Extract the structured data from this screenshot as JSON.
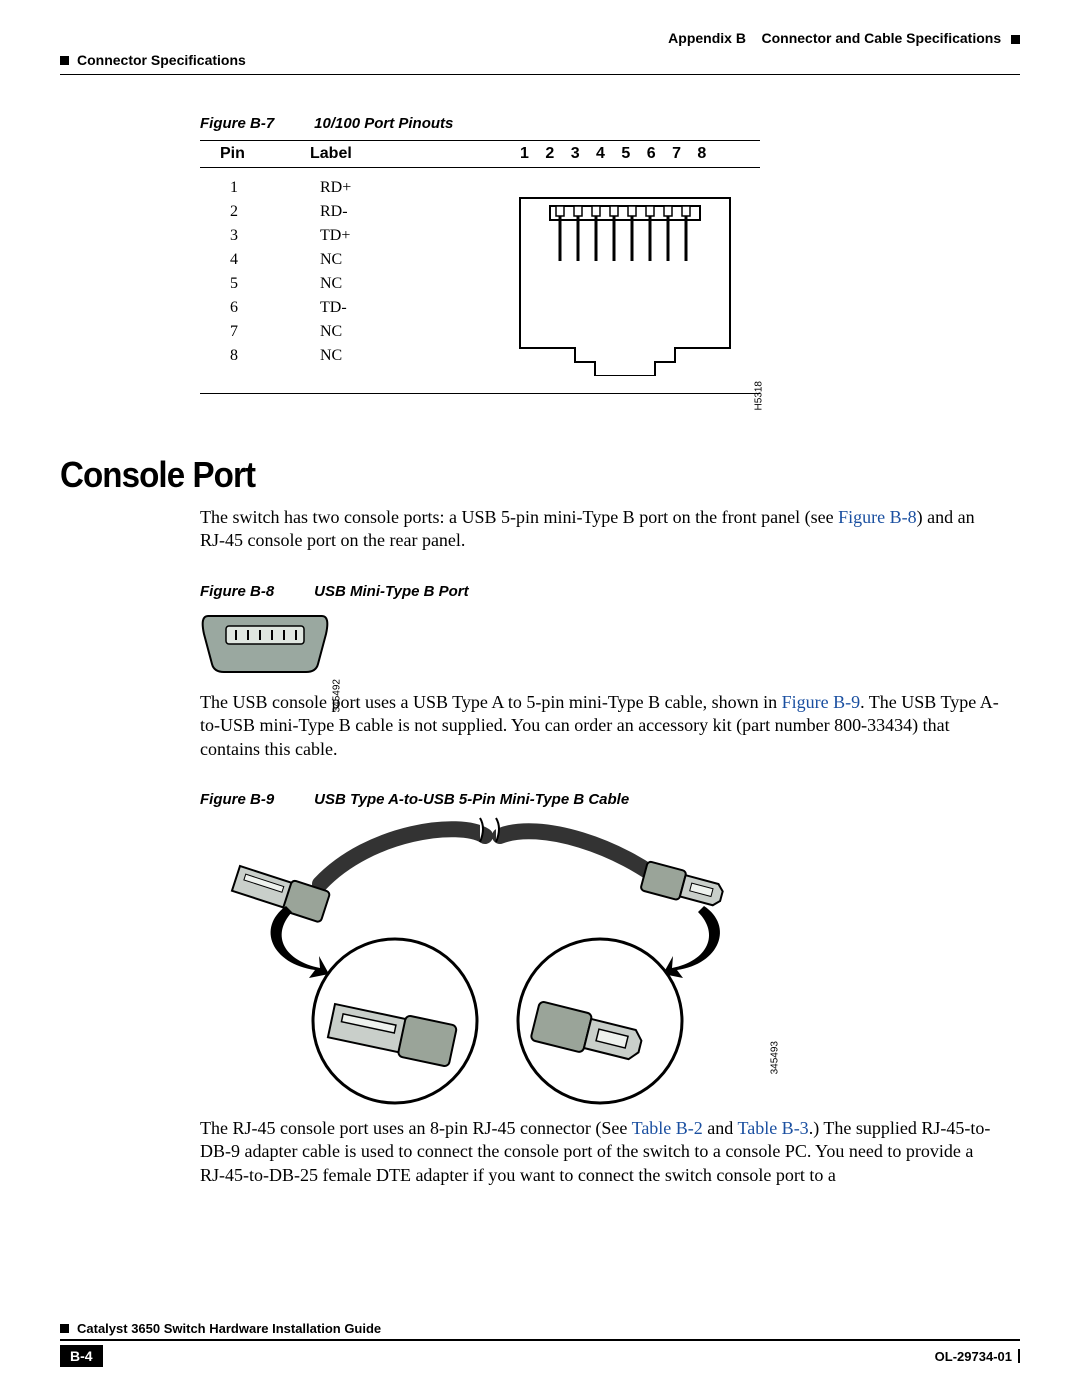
{
  "header": {
    "appendix": "Appendix B",
    "appendix_title": "Connector and Cable Specifications",
    "section": "Connector Specifications"
  },
  "figure_b7": {
    "num": "Figure B-7",
    "title": "10/100 Port Pinouts",
    "col_pin": "Pin",
    "col_label": "Label",
    "numbers": "1 2 3 4 5 6 7 8",
    "rows": [
      {
        "pin": "1",
        "label": "RD+"
      },
      {
        "pin": "2",
        "label": "RD-"
      },
      {
        "pin": "3",
        "label": "TD+"
      },
      {
        "pin": "4",
        "label": "NC"
      },
      {
        "pin": "5",
        "label": "NC"
      },
      {
        "pin": "6",
        "label": "TD-"
      },
      {
        "pin": "7",
        "label": "NC"
      },
      {
        "pin": "8",
        "label": "NC"
      }
    ],
    "drawing_id": "H5318"
  },
  "console": {
    "heading": "Console Port",
    "para1a": "The switch has two console ports: a USB 5-pin mini-Type B port on the front panel (see ",
    "para1_link": "Figure B-8",
    "para1b": ") and an RJ-45 console port on the rear panel.",
    "para2a": "The USB console port uses a USB Type A to 5-pin mini-Type B cable, shown in ",
    "para2_link": "Figure B-9",
    "para2b": ". The USB Type A-to-USB mini-Type B cable is not supplied. You can order an accessory kit (part number 800-33434) that contains this cable.",
    "para3a": "The RJ-45 console port uses an 8-pin RJ-45 connector (See ",
    "para3_link1": "Table B-2",
    "para3_mid": " and ",
    "para3_link2": "Table B-3",
    "para3b": ".) The supplied RJ-45-to-DB-9 adapter cable is used to connect the console port of the switch to a console PC. You need to provide a RJ-45-to-DB-25 female DTE adapter if you want to connect the switch console port to a"
  },
  "figure_b8": {
    "num": "Figure B-8",
    "title": "USB Mini-Type B Port",
    "drawing_id": "345492"
  },
  "figure_b9": {
    "num": "Figure B-9",
    "title": "USB Type A-to-USB 5-Pin Mini-Type B Cable",
    "drawing_id": "345493"
  },
  "footer": {
    "guide": "Catalyst 3650 Switch Hardware Installation Guide",
    "page": "B-4",
    "docnum": "OL-29734-01"
  }
}
